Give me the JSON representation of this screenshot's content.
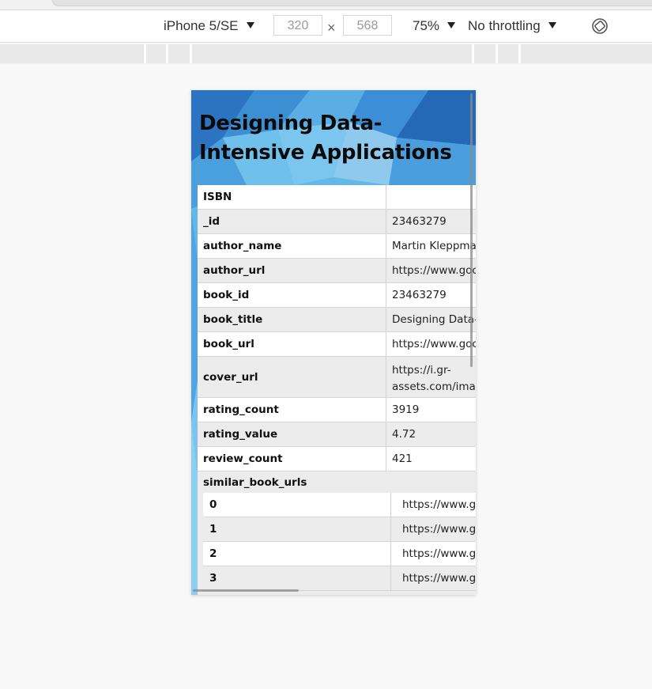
{
  "devtools": {
    "device_name": "iPhone 5/SE",
    "width_value": "320",
    "height_value": "568",
    "dimension_separator": "×",
    "zoom": "75%",
    "throttling": "No throttling",
    "rotate_icon": "rotate-icon"
  },
  "page": {
    "title": "Designing Data-Intensive Applications",
    "rows": [
      {
        "key": "ISBN",
        "value": ""
      },
      {
        "key": "_id",
        "value": "23463279"
      },
      {
        "key": "author_name",
        "value": "Martin Kleppmar"
      },
      {
        "key": "author_url",
        "value": "https://www.goo"
      },
      {
        "key": "book_id",
        "value": "23463279"
      },
      {
        "key": "book_title",
        "value": "Designing Data-I"
      },
      {
        "key": "book_url",
        "value": "https://www.goo"
      },
      {
        "key": "cover_url",
        "value_line1": "https://i.gr-",
        "value_line2": "assets.com/imag"
      },
      {
        "key": "rating_count",
        "value": "3919"
      },
      {
        "key": "rating_value",
        "value": "4.72"
      },
      {
        "key": "review_count",
        "value": "421"
      }
    ],
    "similar": {
      "key": "similar_book_urls",
      "items": [
        {
          "index": "0",
          "value": "https://www.goo"
        },
        {
          "index": "1",
          "value": "https://www.goo"
        },
        {
          "index": "2",
          "value": "https://www.goo"
        },
        {
          "index": "3",
          "value": "https://www.goo"
        }
      ]
    }
  },
  "colors": {
    "bg_primary": "#5fb6e6",
    "bg_dark": "#2c7ac4",
    "row_odd": "#ffffff",
    "row_even": "#ececec"
  }
}
